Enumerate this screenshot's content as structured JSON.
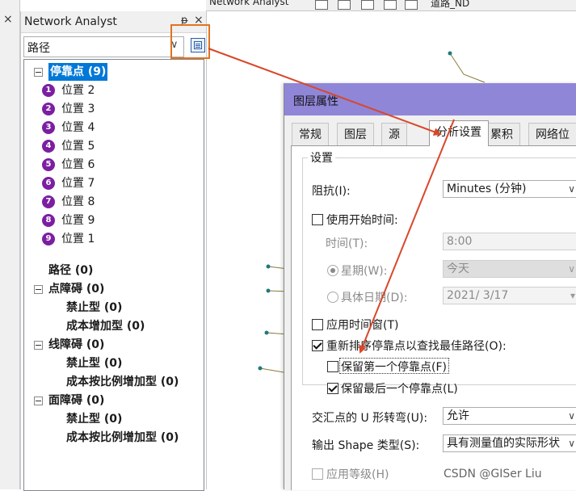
{
  "toolbar": {
    "title_fragment": "Network Analyst",
    "dataset_fragment": "道路_ND"
  },
  "panel": {
    "title": "Network Analyst",
    "pin_glyph": "ᵽ",
    "close_glyph": "×",
    "combo_value": "路径"
  },
  "tree": {
    "stops": {
      "label": "停靠点 (9)",
      "items": [
        {
          "num": "1",
          "label": "位置 2"
        },
        {
          "num": "2",
          "label": "位置 3"
        },
        {
          "num": "3",
          "label": "位置 4"
        },
        {
          "num": "4",
          "label": "位置 5"
        },
        {
          "num": "5",
          "label": "位置 6"
        },
        {
          "num": "6",
          "label": "位置 7"
        },
        {
          "num": "7",
          "label": "位置 8"
        },
        {
          "num": "8",
          "label": "位置 9"
        },
        {
          "num": "9",
          "label": "位置 1"
        }
      ]
    },
    "routes": "路径 (0)",
    "point_barriers": {
      "label": "点障碍 (0)",
      "items": [
        "禁止型 (0)",
        "成本增加型 (0)"
      ]
    },
    "line_barriers": {
      "label": "线障碍 (0)",
      "items": [
        "禁止型 (0)",
        "成本按比例增加型 (0)"
      ]
    },
    "polygon_barriers": {
      "label": "面障碍 (0)",
      "items": [
        "禁止型 (0)",
        "成本按比例增加型 (0)"
      ]
    }
  },
  "dialog": {
    "title": "图层属性",
    "tabs": [
      "常规",
      "图层",
      "源",
      "分析设置",
      "累积",
      "网络位置"
    ],
    "active_tab": "分析设置",
    "group_title": "设置",
    "impedance_label": "阻抗(I):",
    "impedance_value": "Minutes (分钟)",
    "use_start_time": "使用开始时间:",
    "time_label": "时间(T):",
    "time_value": "8:00",
    "weekday_label": "星期(W):",
    "weekday_value": "今天",
    "date_label": "具体日期(D):",
    "date_value": "2021/  3/17",
    "use_time_windows": "应用时间窗(T)",
    "reorder_stops": "重新排序停靠点以查找最佳路径(O):",
    "preserve_first": "保留第一个停靠点(F)",
    "preserve_last": "保留最后一个停靠点(L)",
    "uturn_label": "交汇点的 U 形转弯(U):",
    "uturn_value": "允许",
    "shape_label": "输出 Shape 类型(S):",
    "shape_value": "具有测量值的实际形状",
    "hierarchy_label": "应用等级(H)"
  },
  "watermark": "CSDN @GISer Liu",
  "colors": {
    "title_bar": "#8f86d8",
    "selection": "#0078d7",
    "badge": "#7b1fa2",
    "annotation": "#d9472b",
    "highlight_box": "#e0731f"
  }
}
